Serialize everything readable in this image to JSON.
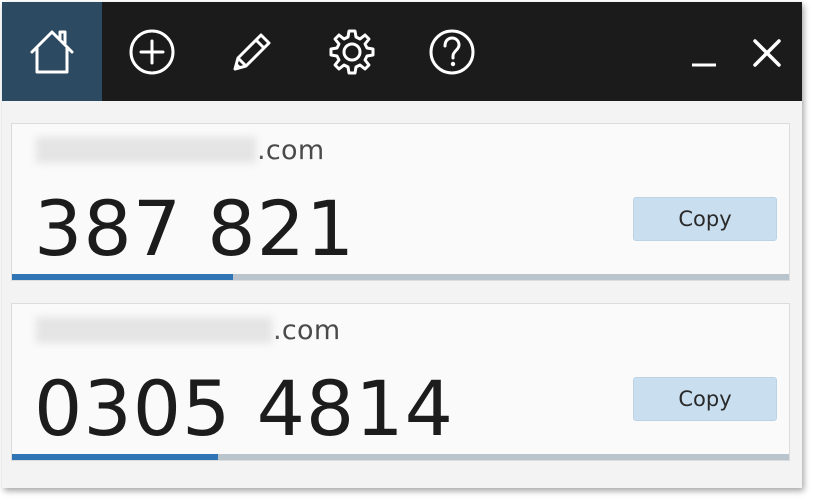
{
  "toolbar": {
    "buttons": [
      {
        "name": "home",
        "icon": "home-icon",
        "active": true
      },
      {
        "name": "add",
        "icon": "plus-circle-icon",
        "active": false
      },
      {
        "name": "edit",
        "icon": "pencil-icon",
        "active": false
      },
      {
        "name": "settings",
        "icon": "gear-icon",
        "active": false
      },
      {
        "name": "help",
        "icon": "question-circle-icon",
        "active": false
      }
    ],
    "window_controls": {
      "minimize_icon": "minimize-icon",
      "close_icon": "close-icon"
    }
  },
  "accounts": [
    {
      "domain_suffix": ".com",
      "code": "387 821",
      "copy_label": "Copy",
      "progress": 0.285
    },
    {
      "domain_suffix": ".com",
      "code": "0305 4814",
      "copy_label": "Copy",
      "progress": 0.265
    }
  ],
  "colors": {
    "toolbar_bg": "#1b1b1b",
    "active_tab_bg": "#2c4a62",
    "copy_button_bg": "#c9dff0",
    "progress_fill": "#2f75b5",
    "progress_track": "#b9c4cc"
  }
}
